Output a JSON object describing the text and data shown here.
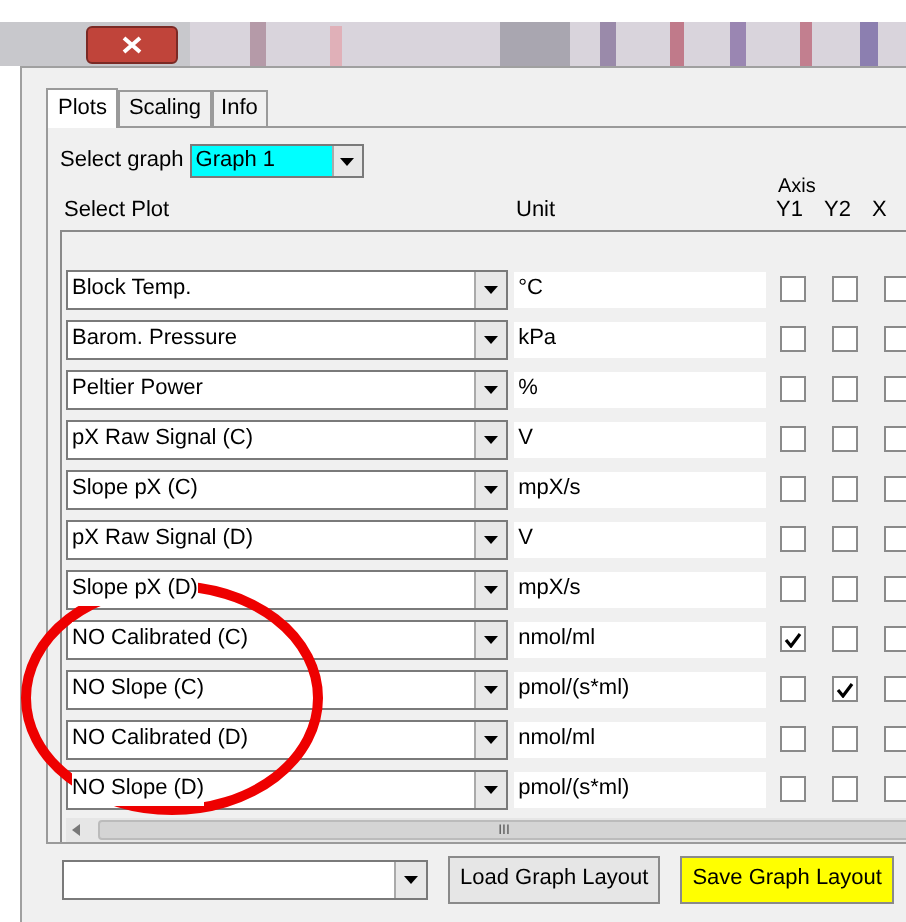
{
  "tabs": [
    {
      "label": "Plots",
      "selected": true
    },
    {
      "label": "Scaling",
      "selected": false
    },
    {
      "label": "Info",
      "selected": false
    }
  ],
  "select_graph": {
    "label": "Select graph",
    "value": "Graph 1"
  },
  "headers": {
    "plot": "Select Plot",
    "unit": "Unit",
    "axis": "Axis",
    "y1": "Y1",
    "y2": "Y2",
    "x": "X"
  },
  "rows": [
    {
      "plot": "Block Temp.",
      "unit": "°C",
      "y1": false,
      "y2": false,
      "x": false
    },
    {
      "plot": "Barom. Pressure",
      "unit": "kPa",
      "y1": false,
      "y2": false,
      "x": false
    },
    {
      "plot": "Peltier Power",
      "unit": "%",
      "y1": false,
      "y2": false,
      "x": false
    },
    {
      "plot": "pX Raw Signal (C)",
      "unit": "V",
      "y1": false,
      "y2": false,
      "x": false
    },
    {
      "plot": "Slope pX (C)",
      "unit": "mpX/s",
      "y1": false,
      "y2": false,
      "x": false
    },
    {
      "plot": "pX Raw Signal (D)",
      "unit": "V",
      "y1": false,
      "y2": false,
      "x": false
    },
    {
      "plot": "Slope pX (D)",
      "unit": "mpX/s",
      "y1": false,
      "y2": false,
      "x": false
    },
    {
      "plot": "NO Calibrated (C)",
      "unit": "nmol/ml",
      "y1": true,
      "y2": false,
      "x": false
    },
    {
      "plot": "NO Slope (C)",
      "unit": "pmol/(s*ml)",
      "y1": false,
      "y2": true,
      "x": false
    },
    {
      "plot": "NO Calibrated (D)",
      "unit": "nmol/ml",
      "y1": false,
      "y2": false,
      "x": false
    },
    {
      "plot": "NO Slope (D)",
      "unit": "pmol/(s*ml)",
      "y1": false,
      "y2": false,
      "x": false
    }
  ],
  "scrollbar_grip": "III",
  "bottom": {
    "buttons": [
      {
        "label": "Load Graph Layout",
        "highlighted": false
      },
      {
        "label": "Save Graph Layout",
        "highlighted": true
      }
    ]
  }
}
